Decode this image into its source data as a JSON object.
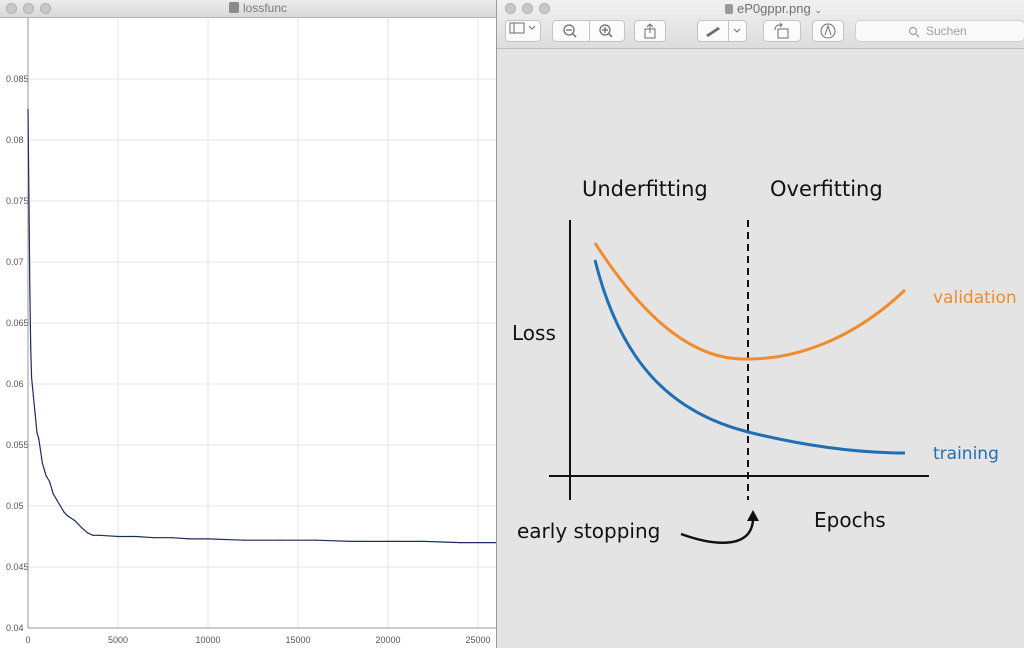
{
  "left_window": {
    "title": "lossfunc",
    "chart_data": {
      "type": "line",
      "title": "",
      "xlabel": "",
      "ylabel": "",
      "xlim": [
        0,
        26000
      ],
      "ylim": [
        0.04,
        0.09
      ],
      "grid": true,
      "x_ticks": [
        "0",
        "5000",
        "10000",
        "15000",
        "20000",
        "25000"
      ],
      "y_ticks": [
        "0.04",
        "0.045",
        "0.05",
        "0.055",
        "0.06",
        "0.065",
        "0.07",
        "0.075",
        "0.08",
        "0.085"
      ],
      "series": [
        {
          "color": "#1c2d5a",
          "x": [
            0,
            50,
            100,
            150,
            200,
            300,
            400,
            500,
            600,
            700,
            800,
            900,
            1000,
            1200,
            1400,
            1600,
            1800,
            2000,
            2200,
            2400,
            2600,
            2800,
            3000,
            3300,
            3600,
            4000,
            5000,
            6000,
            7000,
            8000,
            9000,
            10000,
            12000,
            14000,
            16000,
            18000,
            20000,
            22000,
            24000,
            26000
          ],
          "y": [
            0.0825,
            0.0755,
            0.068,
            0.063,
            0.0605,
            0.059,
            0.0575,
            0.056,
            0.0555,
            0.0545,
            0.0535,
            0.053,
            0.0525,
            0.052,
            0.051,
            0.0505,
            0.05,
            0.0495,
            0.0492,
            0.049,
            0.0488,
            0.0485,
            0.0482,
            0.0478,
            0.0476,
            0.0476,
            0.0475,
            0.0475,
            0.0474,
            0.0474,
            0.0473,
            0.0473,
            0.0472,
            0.0472,
            0.0472,
            0.0471,
            0.0471,
            0.0471,
            0.047,
            0.047
          ]
        }
      ]
    }
  },
  "right_window": {
    "title": "eP0gppr.png",
    "search_placeholder": "Suchen",
    "toolbar": {
      "icons": [
        "sidebar-icon",
        "zoom-out-icon",
        "zoom-in-icon",
        "share-icon",
        "markup-pen-icon",
        "rotate-icon",
        "annotate-icon",
        "search-icon"
      ]
    },
    "diagram": {
      "region_left": "Underfitting",
      "region_right": "Overfitting",
      "y_axis_label": "Loss",
      "x_axis_label": "Epochs",
      "marker_label": "early stopping",
      "validation_label": "validation",
      "training_label": "training",
      "validation_color": "#f08c2e",
      "training_color": "#1f6fb5"
    }
  }
}
